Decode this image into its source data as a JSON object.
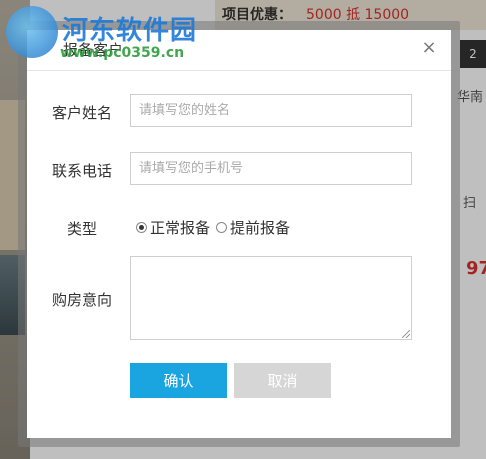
{
  "background": {
    "promo_label": "项目优惠：",
    "promo_value": "5000 抵 15000",
    "right_text_1": "华南",
    "right_text_2": "扫",
    "right_number": "97",
    "right_box": "2"
  },
  "watermark": {
    "title": "河东软件园",
    "url": "www.pc0359.cn"
  },
  "modal": {
    "title": "报备客户",
    "close_icon": "×",
    "fields": {
      "name_label": "客户姓名",
      "name_placeholder": "请填写您的姓名",
      "phone_label": "联系电话",
      "phone_placeholder": "请填写您的手机号",
      "type_label": "类型",
      "type_options": [
        "正常报备",
        "提前报备"
      ],
      "type_selected": "正常报备",
      "intent_label": "购房意向"
    },
    "buttons": {
      "confirm": "确认",
      "cancel": "取消"
    }
  },
  "colors": {
    "confirm_button": "#1aa5e0",
    "cancel_button": "#d6d6d6",
    "promo_red": "#d9322e"
  }
}
